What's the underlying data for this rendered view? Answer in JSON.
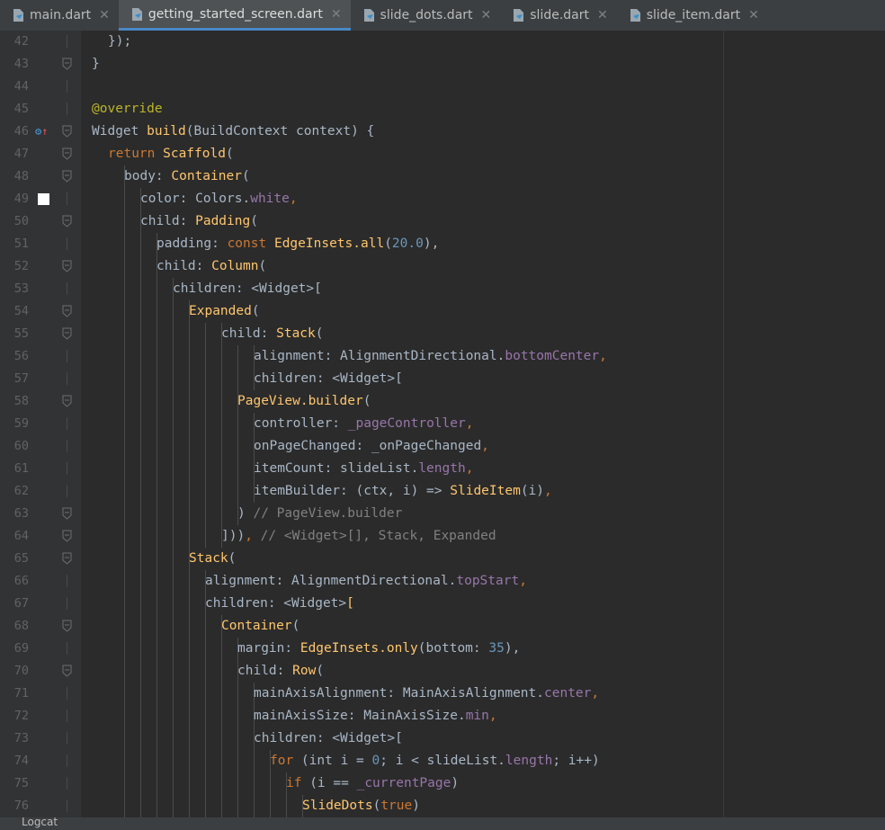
{
  "tabs": [
    {
      "label": "main.dart",
      "active": false
    },
    {
      "label": "getting_started_screen.dart",
      "active": true
    },
    {
      "label": "slide_dots.dart",
      "active": false
    },
    {
      "label": "slide.dart",
      "active": false
    },
    {
      "label": "slide_item.dart",
      "active": false
    }
  ],
  "tab_close_glyph": "✕",
  "colors": {
    "background": "#2b2b2b",
    "keyword": "#cc7832",
    "function": "#ffc66d",
    "number": "#6897bb",
    "field": "#9876aa",
    "comment": "#808080",
    "annotation": "#bbb529",
    "text": "#a9b7c6"
  },
  "lines": [
    {
      "n": "42",
      "indent": 1,
      "t": [
        [
          "p",
          "});"
        ]
      ],
      "fold": false
    },
    {
      "n": "43",
      "indent": 0,
      "t": [
        [
          "p",
          "}"
        ]
      ],
      "fold": true
    },
    {
      "n": "44",
      "indent": 0,
      "t": [],
      "fold": false
    },
    {
      "n": "45",
      "indent": 0,
      "t": [
        [
          "ann",
          "@override"
        ]
      ],
      "fold": false
    },
    {
      "n": "46",
      "indent": 0,
      "t": [
        [
          "p",
          "Widget "
        ],
        [
          "fn",
          "build"
        ],
        [
          "p",
          "(BuildContext context) {"
        ]
      ],
      "fold": true,
      "marker": "override"
    },
    {
      "n": "47",
      "indent": 1,
      "t": [
        [
          "kw",
          "return "
        ],
        [
          "fn",
          "Scaffold"
        ],
        [
          "p",
          "("
        ]
      ],
      "fold": true
    },
    {
      "n": "48",
      "indent": 2,
      "t": [
        [
          "p",
          "body: "
        ],
        [
          "fn",
          "Container"
        ],
        [
          "p",
          "("
        ]
      ],
      "fold": true
    },
    {
      "n": "49",
      "indent": 3,
      "t": [
        [
          "p",
          "color: Colors."
        ],
        [
          "fld",
          "white"
        ],
        [
          "kw",
          ","
        ]
      ],
      "fold": false,
      "marker": "swatch"
    },
    {
      "n": "50",
      "indent": 3,
      "t": [
        [
          "p",
          "child: "
        ],
        [
          "fn",
          "Padding"
        ],
        [
          "p",
          "("
        ]
      ],
      "fold": true
    },
    {
      "n": "51",
      "indent": 4,
      "t": [
        [
          "p",
          "padding: "
        ],
        [
          "kw",
          "const "
        ],
        [
          "fn",
          "EdgeInsets.all"
        ],
        [
          "p",
          "("
        ],
        [
          "num",
          "20.0"
        ],
        [
          "p",
          "),"
        ]
      ],
      "fold": false
    },
    {
      "n": "52",
      "indent": 4,
      "t": [
        [
          "p",
          "child: "
        ],
        [
          "fn",
          "Column"
        ],
        [
          "p",
          "("
        ]
      ],
      "fold": true
    },
    {
      "n": "53",
      "indent": 5,
      "t": [
        [
          "p",
          "children: <Widget>["
        ]
      ],
      "fold": false
    },
    {
      "n": "54",
      "indent": 6,
      "t": [
        [
          "fn",
          "Expanded"
        ],
        [
          "p",
          "("
        ]
      ],
      "fold": true
    },
    {
      "n": "55",
      "indent": 8,
      "t": [
        [
          "p",
          "child: "
        ],
        [
          "fn",
          "Stack"
        ],
        [
          "p",
          "("
        ]
      ],
      "fold": true
    },
    {
      "n": "56",
      "indent": 10,
      "t": [
        [
          "p",
          "alignment: AlignmentDirectional."
        ],
        [
          "fld",
          "bottomCenter"
        ],
        [
          "kw",
          ","
        ]
      ],
      "fold": false
    },
    {
      "n": "57",
      "indent": 10,
      "t": [
        [
          "p",
          "children: <Widget>["
        ]
      ],
      "fold": false
    },
    {
      "n": "58",
      "indent": 9,
      "t": [
        [
          "fn",
          "PageView.builder"
        ],
        [
          "p",
          "("
        ]
      ],
      "fold": true
    },
    {
      "n": "59",
      "indent": 10,
      "t": [
        [
          "p",
          "controller: "
        ],
        [
          "fld",
          "_pageController"
        ],
        [
          "kw",
          ","
        ]
      ],
      "fold": false
    },
    {
      "n": "60",
      "indent": 10,
      "t": [
        [
          "p",
          "onPageChanged: "
        ],
        [
          "p",
          "_onPageChanged"
        ],
        [
          "kw",
          ","
        ]
      ],
      "fold": false
    },
    {
      "n": "61",
      "indent": 10,
      "t": [
        [
          "p",
          "itemCount: slideList."
        ],
        [
          "fld",
          "length"
        ],
        [
          "kw",
          ","
        ]
      ],
      "fold": false
    },
    {
      "n": "62",
      "indent": 10,
      "t": [
        [
          "p",
          "itemBuilder: (ctx, i) => "
        ],
        [
          "fn",
          "SlideItem"
        ],
        [
          "p",
          "(i)"
        ],
        [
          "kw",
          ","
        ]
      ],
      "fold": false
    },
    {
      "n": "63",
      "indent": 9,
      "t": [
        [
          "p",
          ") "
        ],
        [
          "cmt",
          "// PageView.builder"
        ]
      ],
      "fold": true
    },
    {
      "n": "64",
      "indent": 8,
      "t": [
        [
          "p",
          "]))"
        ],
        [
          "kw",
          ", "
        ],
        [
          "cmt",
          "// <Widget>[], Stack, Expanded"
        ]
      ],
      "fold": true
    },
    {
      "n": "65",
      "indent": 6,
      "t": [
        [
          "fn",
          "Stack"
        ],
        [
          "p",
          "("
        ]
      ],
      "fold": true
    },
    {
      "n": "66",
      "indent": 7,
      "t": [
        [
          "p",
          "alignment: AlignmentDirectional."
        ],
        [
          "fld",
          "topStart"
        ],
        [
          "kw",
          ","
        ]
      ],
      "fold": false
    },
    {
      "n": "67",
      "indent": 7,
      "t": [
        [
          "p",
          "children: <Widget>"
        ],
        [
          "fn",
          "["
        ]
      ],
      "fold": false
    },
    {
      "n": "68",
      "indent": 8,
      "t": [
        [
          "fn",
          "Container"
        ],
        [
          "p",
          "("
        ]
      ],
      "fold": true
    },
    {
      "n": "69",
      "indent": 9,
      "t": [
        [
          "p",
          "margin: "
        ],
        [
          "fn",
          "EdgeInsets.only"
        ],
        [
          "p",
          "(bottom: "
        ],
        [
          "num",
          "35"
        ],
        [
          "p",
          "),"
        ]
      ],
      "fold": false
    },
    {
      "n": "70",
      "indent": 9,
      "t": [
        [
          "p",
          "child: "
        ],
        [
          "fn",
          "Row"
        ],
        [
          "p",
          "("
        ]
      ],
      "fold": true
    },
    {
      "n": "71",
      "indent": 10,
      "t": [
        [
          "p",
          "mainAxisAlignment: MainAxisAlignment."
        ],
        [
          "fld",
          "center"
        ],
        [
          "kw",
          ","
        ]
      ],
      "fold": false
    },
    {
      "n": "72",
      "indent": 10,
      "t": [
        [
          "p",
          "mainAxisSize: MainAxisSize."
        ],
        [
          "fld",
          "min"
        ],
        [
          "kw",
          ","
        ]
      ],
      "fold": false
    },
    {
      "n": "73",
      "indent": 10,
      "t": [
        [
          "p",
          "children: <Widget>["
        ]
      ],
      "fold": false
    },
    {
      "n": "74",
      "indent": 11,
      "t": [
        [
          "kw",
          "for "
        ],
        [
          "p",
          "(int i = "
        ],
        [
          "num",
          "0"
        ],
        [
          "p",
          "; i < slideList."
        ],
        [
          "fld",
          "length"
        ],
        [
          "p",
          "; i++)"
        ]
      ],
      "fold": false
    },
    {
      "n": "75",
      "indent": 12,
      "t": [
        [
          "kw",
          "if "
        ],
        [
          "p",
          "(i == "
        ],
        [
          "fld",
          "_currentPage"
        ],
        [
          "p",
          ")"
        ]
      ],
      "fold": false
    },
    {
      "n": "76",
      "indent": 13,
      "t": [
        [
          "fn",
          "SlideDots"
        ],
        [
          "p",
          "("
        ],
        [
          "kw",
          "true"
        ],
        [
          "p",
          ")"
        ]
      ],
      "fold": false
    }
  ],
  "status": {
    "label": "Logcat"
  }
}
